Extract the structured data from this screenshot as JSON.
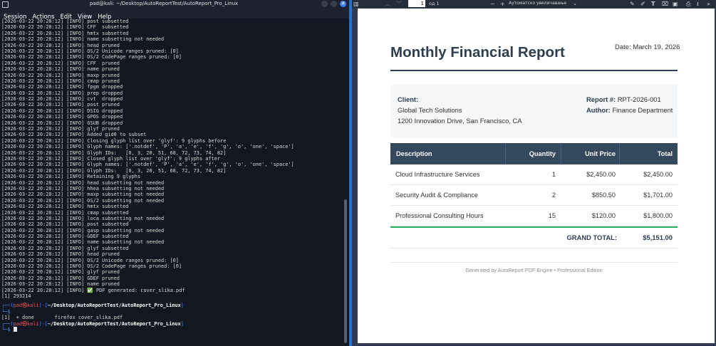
{
  "terminal": {
    "title": "pad@kali: ~/Desktop/AutoReportTest/AutoReport_Pro_Linux",
    "menu": [
      "Session",
      "Actions",
      "Edit",
      "View",
      "Help"
    ],
    "log_lines": [
      "[2026-03-22 20:28:12] [INFO] post subsetted",
      "[2026-03-22 20:28:12] [INFO] CFF  subsetted",
      "[2026-03-22 20:28:12] [INFO] hmtx subsetted",
      "[2026-03-22 20:28:12] [INFO] name subsetting not needed",
      "[2026-03-22 20:28:12] [INFO] head pruned",
      "[2026-03-22 20:28:12] [INFO] OS/2 Unicode ranges pruned: [0]",
      "[2026-03-22 20:28:12] [INFO] OS/2 CodePage ranges pruned: [0]",
      "[2026-03-22 20:28:12] [INFO] CFF  pruned",
      "[2026-03-22 20:28:12] [INFO] name pruned",
      "[2026-03-22 20:28:12] [INFO] maxp pruned",
      "[2026-03-22 20:28:12] [INFO] cmap pruned",
      "[2026-03-22 20:28:12] [INFO] fpgm dropped",
      "[2026-03-22 20:28:12] [INFO] prep dropped",
      "[2026-03-22 20:28:12] [INFO] cvt  dropped",
      "[2026-03-22 20:28:12] [INFO] post pruned",
      "[2026-03-22 20:28:12] [INFO] DSIG dropped",
      "[2026-03-22 20:28:12] [INFO] GPOS dropped",
      "[2026-03-22 20:28:12] [INFO] GSUB dropped",
      "[2026-03-22 20:28:12] [INFO] glyf pruned",
      "[2026-03-22 20:28:12] [INFO] Added gid0 to subset",
      "[2026-03-22 20:28:12] [INFO] Closing glyph list over 'glyf': 9 glyphs before",
      "[2026-03-22 20:28:12] [INFO] Glyph names: ['.notdef', 'P', 'a', 'e', 'f', 'g', 'o', 'one', 'space']",
      "[2026-03-22 20:28:12] [INFO] Glyph IDs:   [0, 3, 20, 51, 68, 72, 73, 74, 82]",
      "[2026-03-22 20:28:12] [INFO] Closed glyph list over 'glyf': 9 glyphs after",
      "[2026-03-22 20:28:12] [INFO] Glyph names: ['.notdef', 'P', 'a', 'e', 'f', 'g', 'o', 'one', 'space']",
      "[2026-03-22 20:28:12] [INFO] Glyph IDs:   [0, 3, 20, 51, 68, 72, 73, 74, 82]",
      "[2026-03-22 20:28:12] [INFO] Retaining 9 glyphs",
      "[2026-03-22 20:28:12] [INFO] head subsetting not needed",
      "[2026-03-22 20:28:12] [INFO] hhea subsetting not needed",
      "[2026-03-22 20:28:12] [INFO] maxp subsetting not needed",
      "[2026-03-22 20:28:12] [INFO] OS/2 subsetting not needed",
      "[2026-03-22 20:28:12] [INFO] hmtx subsetted",
      "[2026-03-22 20:28:12] [INFO] cmap subsetted",
      "[2026-03-22 20:28:12] [INFO] loca subsetting not needed",
      "[2026-03-22 20:28:12] [INFO] post subsetted",
      "[2026-03-22 20:28:12] [INFO] gasp subsetting not needed",
      "[2026-03-22 20:28:12] [INFO] GDEF subsetted",
      "[2026-03-22 20:28:12] [INFO] name subsetting not needed",
      "[2026-03-22 20:28:12] [INFO] glyf subsetted",
      "[2026-03-22 20:28:12] [INFO] head pruned",
      "[2026-03-22 20:28:12] [INFO] OS/2 Unicode ranges pruned: [0]",
      "[2026-03-22 20:28:12] [INFO] OS/2 CodePage ranges pruned: [0]",
      "[2026-03-22 20:28:12] [INFO] glyf pruned",
      "[2026-03-22 20:28:12] [INFO] GDEF pruned",
      "[2026-03-22 20:28:12] [INFO] name pruned",
      "[2026-03-22 20:28:12] [INFO] ✅ PDF generated: cover_slika.pdf",
      "[1] 293214"
    ],
    "prompt": {
      "user": "pad",
      "host": "kali",
      "path": "~/Desktop/AutoReportTest/AutoReport_Pro_Linux",
      "symbol": "$"
    },
    "job_done_line": "[1]  + done       firefox cover_slika.pdf",
    "colors": {
      "background": "#131722",
      "prompt_blue": "#4d8cf5",
      "prompt_red": "#ff4b4b"
    }
  },
  "viewer": {
    "page_number": "1",
    "page_of": "од 1",
    "zoom": "Аутоматско увеличавање",
    "icons": [
      "sidebar-toggle-icon",
      "prev-page-icon",
      "next-page-icon",
      "zoom-out-icon",
      "zoom-in-icon",
      "chevron-down-icon",
      "edit-icon",
      "draw-icon",
      "text-icon",
      "highlight-icon",
      "image-icon",
      "print-icon",
      "save-icon",
      "more-icon"
    ]
  },
  "report": {
    "title": "Monthly Financial Report",
    "date_label": "Date:",
    "date_value": "March 19, 2026",
    "client_label": "Client:",
    "client_name": "Global Tech Solutions",
    "client_address": "1200 Innovation Drive, San Francisco, CA",
    "report_no_label": "Report #:",
    "report_no_value": "RPT-2026-001",
    "author_label": "Author:",
    "author_value": "Finance Department",
    "table": {
      "headers": [
        "Description",
        "Quantity",
        "Unit Price",
        "Total"
      ],
      "rows": [
        [
          "Cloud Infrastructure Services",
          "1",
          "$2,450.00",
          "$2,450.00"
        ],
        [
          "Security Audit & Compliance",
          "2",
          "$850.50",
          "$1,701.00"
        ],
        [
          "Professional Consulting Hours",
          "15",
          "$120.00",
          "$1,800.00"
        ]
      ],
      "grand_total_label": "GRAND TOTAL:",
      "grand_total_value": "$5,151.00"
    },
    "footer": "Generated by AutoReport PDF Engine • Professional Edition",
    "colors": {
      "heading": "#2c3e50",
      "table_header": "#34495e",
      "accent_green": "#27ae60"
    }
  }
}
